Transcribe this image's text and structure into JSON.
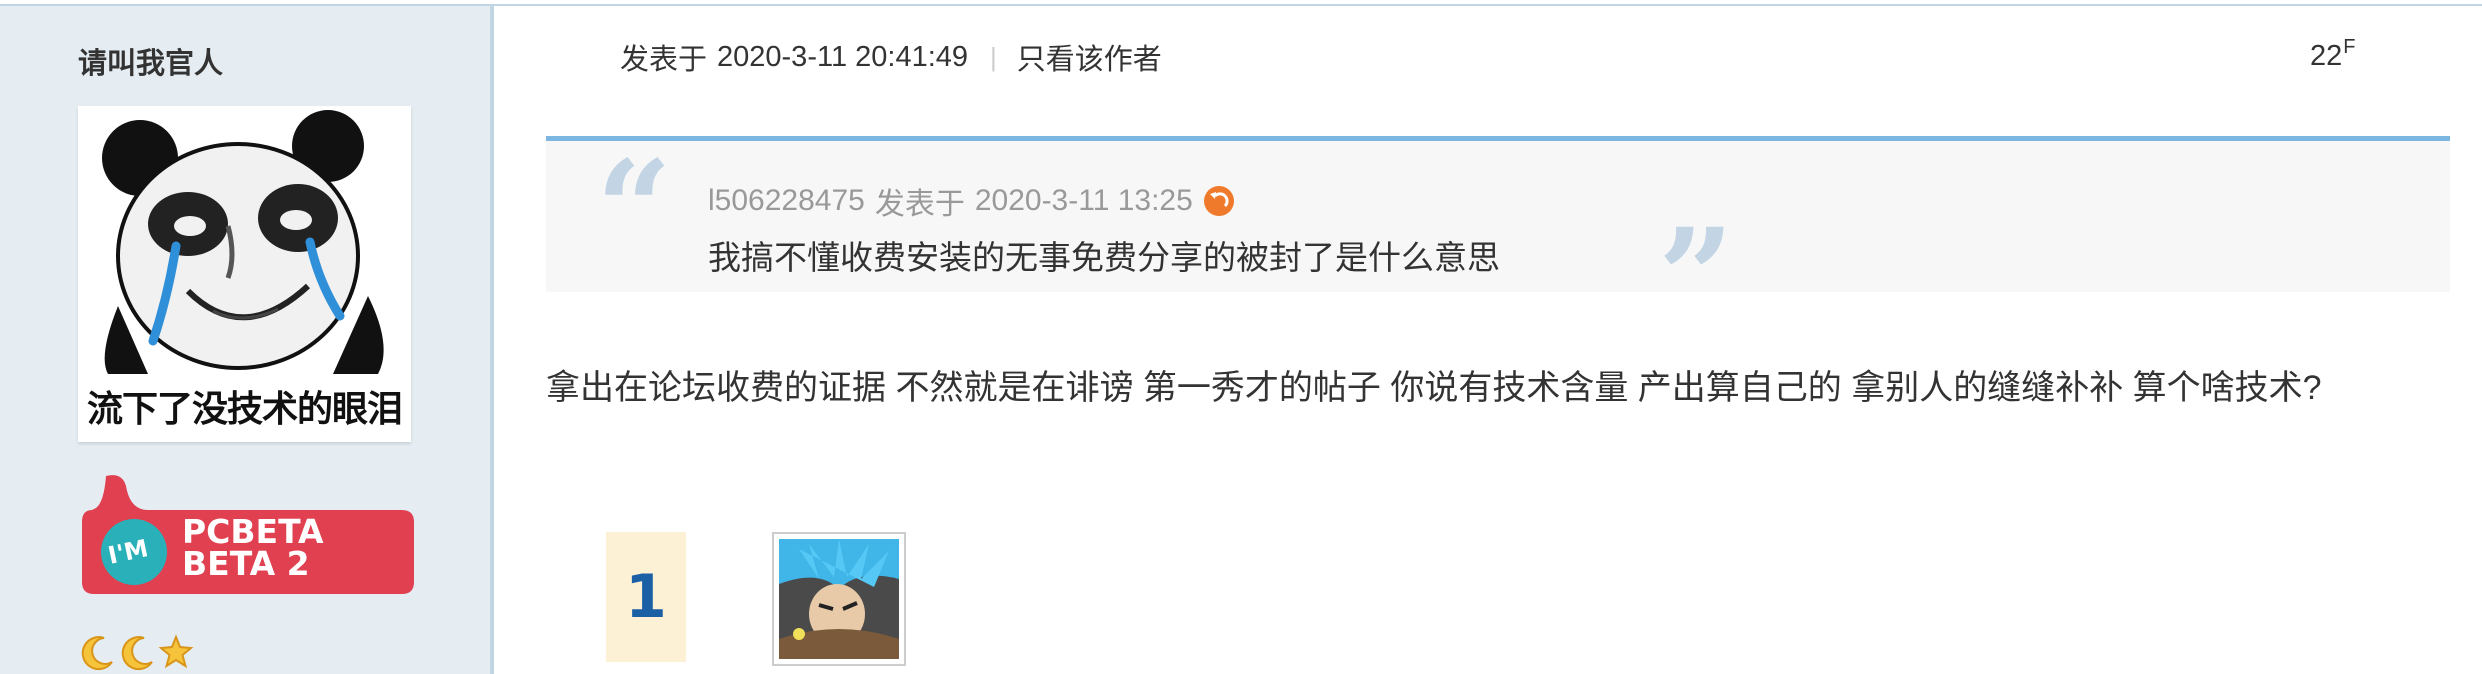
{
  "author": {
    "name": "请叫我官人",
    "avatar_caption": "流下了没技术的眼泪",
    "badge": {
      "line1": "PCBETA",
      "line2": "BETA 2",
      "mark": "I'M"
    },
    "rank_icons": [
      "moon-icon",
      "moon-icon",
      "star-icon"
    ]
  },
  "post": {
    "posted_label": "发表于",
    "timestamp": "2020-3-11 20:41:49",
    "only_author_link": "只看该作者",
    "floor_number": "22",
    "floor_suffix": "F",
    "quote": {
      "username": "l506228475",
      "posted_label": "发表于",
      "timestamp": "2020-3-11 13:25",
      "text": "我搞不懂收费安装的无事免费分享的被封了是什么意思"
    },
    "body": "拿出在论坛收费的证据 不然就是在诽谤  第一秀才的帖子 你说有技术含量 产出算自己的 拿别人的缝缝补补 算个啥技术?"
  },
  "rating": {
    "count": "1"
  },
  "colors": {
    "sidebar_bg": "#e5edf2",
    "quote_border": "#7cb7e4",
    "badge_red": "#e04050",
    "rate_num": "#1b5fa5"
  }
}
